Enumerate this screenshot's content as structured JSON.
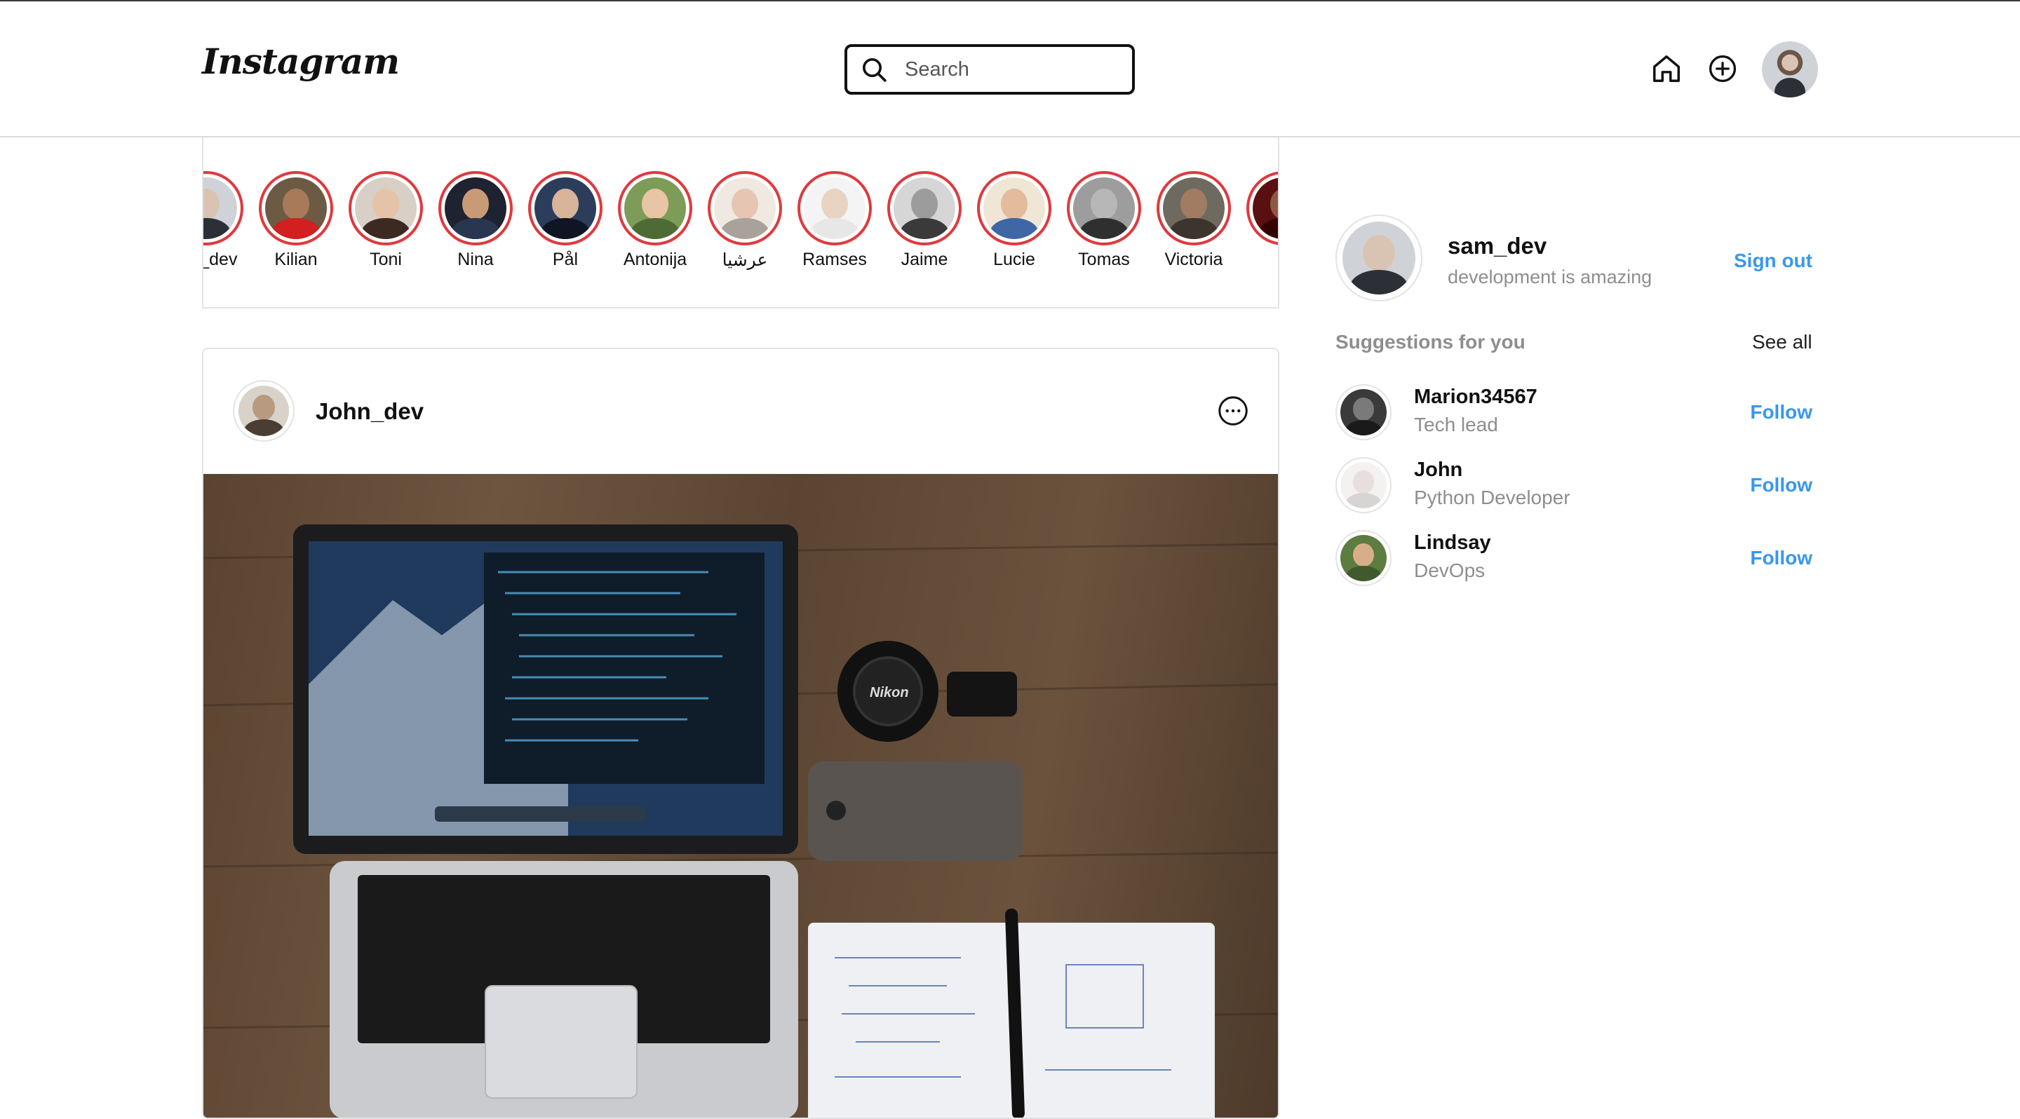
{
  "header": {
    "logo_text": "Instagram",
    "search_placeholder": "Search"
  },
  "stories": [
    {
      "username": "sam_dev",
      "display": "am_dev",
      "skin": "#d9c4b3",
      "shirt": "#2c2f36",
      "bg": "#cfd3d8"
    },
    {
      "username": "Kilian",
      "display": "Kilian",
      "skin": "#a97a5a",
      "shirt": "#d21f1f",
      "bg": "#6d5a44"
    },
    {
      "username": "Toni",
      "display": "Toni",
      "skin": "#e5c3a8",
      "shirt": "#3c2a20",
      "bg": "#d8cfc6"
    },
    {
      "username": "Nina",
      "display": "Nina",
      "skin": "#c89a76",
      "shirt": "#28374f",
      "bg": "#1f2230"
    },
    {
      "username": "Pål",
      "display": "Pål",
      "skin": "#d7b49a",
      "shirt": "#0f1522",
      "bg": "#2b3d5b"
    },
    {
      "username": "Antonija",
      "display": "Antonija",
      "skin": "#e8c5a4",
      "shirt": "#4f6b35",
      "bg": "#7c9c58"
    },
    {
      "username": "عرشيا",
      "display": "عرشيا",
      "skin": "#e6c6b2",
      "shirt": "#a9a19a",
      "bg": "#efe9e2"
    },
    {
      "username": "Ramses",
      "display": "Ramses",
      "skin": "#e9d3c2",
      "shirt": "#e7e7e7",
      "bg": "#f4f4f4"
    },
    {
      "username": "Jaime",
      "display": "Jaime",
      "skin": "#9c9c9c",
      "shirt": "#3a3a3a",
      "bg": "#d6d6d6"
    },
    {
      "username": "Lucie",
      "display": "Lucie",
      "skin": "#e2bc9c",
      "shirt": "#3f67a5",
      "bg": "#efe6d6"
    },
    {
      "username": "Tomas",
      "display": "Tomas",
      "skin": "#b7b7b7",
      "shirt": "#2f2f2f",
      "bg": "#9d9d9d"
    },
    {
      "username": "Victoria",
      "display": "Victoria",
      "skin": "#a17c63",
      "shirt": "#3d342d",
      "bg": "#6e6a60"
    },
    {
      "username": "",
      "display": "",
      "skin": "#8a5a45",
      "shirt": "#300",
      "bg": "#5a1010"
    }
  ],
  "post": {
    "username": "John_dev"
  },
  "sidebar": {
    "user": {
      "username": "sam_dev",
      "bio": "development is amazing"
    },
    "sign_out_label": "Sign out",
    "suggestions_title": "Suggestions for you",
    "see_all_label": "See all",
    "suggestions": [
      {
        "username": "Marion34567",
        "bio": "Tech lead",
        "follow_label": "Follow",
        "skin": "#7a7a7a",
        "shirt": "#1a1a1a",
        "bg": "#3a3a3a"
      },
      {
        "username": "John",
        "bio": "Python Developer",
        "follow_label": "Follow",
        "skin": "#e8dede",
        "shirt": "#d9d4d4",
        "bg": "#f4f1f1"
      },
      {
        "username": "Lindsay",
        "bio": "DevOps",
        "follow_label": "Follow",
        "skin": "#d7ae88",
        "shirt": "#405a2e",
        "bg": "#5c7c40"
      }
    ]
  }
}
